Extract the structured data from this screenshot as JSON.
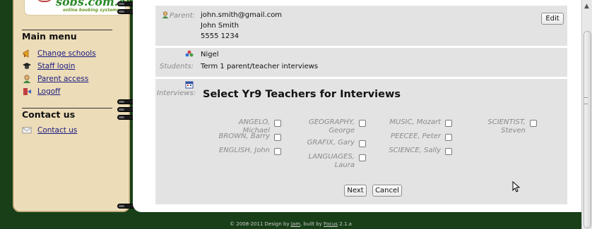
{
  "logo": {
    "text": "sobs.com.au",
    "tagline": "online booking systems"
  },
  "sidebar": {
    "main_menu_heading": "Main menu",
    "items": [
      {
        "label": "Change schools",
        "icon": "megaphone-icon"
      },
      {
        "label": "Staff login",
        "icon": "graduation-cap-icon"
      },
      {
        "label": "Parent access",
        "icon": "user-icon"
      },
      {
        "label": "Logoff",
        "icon": "door-exit-icon"
      }
    ],
    "contact_heading": "Contact us",
    "contact_item": {
      "label": "Contact us",
      "icon": "envelope-icon"
    }
  },
  "parent": {
    "label": "Parent:",
    "email": "john.smith@gmail.com",
    "name": "John Smith",
    "phone": "5555 1234",
    "edit_label": "Edit"
  },
  "students": {
    "label": "Students:",
    "student_name": "Nigel",
    "event": "Term 1 parent/teacher interviews"
  },
  "interviews": {
    "label": "Interviews:",
    "title": "Select Yr9 Teachers for Interviews",
    "columns": [
      [
        "ANGELO, Michael",
        "BROWN, Barry",
        "ENGLISH, John"
      ],
      [
        "GEOGRAPHY, George",
        "GRAFIX, Gary",
        "LANGUAGES, Laura"
      ],
      [
        "MUSIC, Mozart",
        "PEECEE, Peter",
        "SCIENCE, Sally"
      ],
      [
        "SCIENTIST, Steven"
      ]
    ],
    "next_label": "Next",
    "cancel_label": "Cancel"
  },
  "footer": {
    "prefix": "© 2008-2011 Design by",
    "design_link": "Jam",
    "middle": ", built by",
    "built_link": "Focus",
    "version": "2.1.a"
  }
}
